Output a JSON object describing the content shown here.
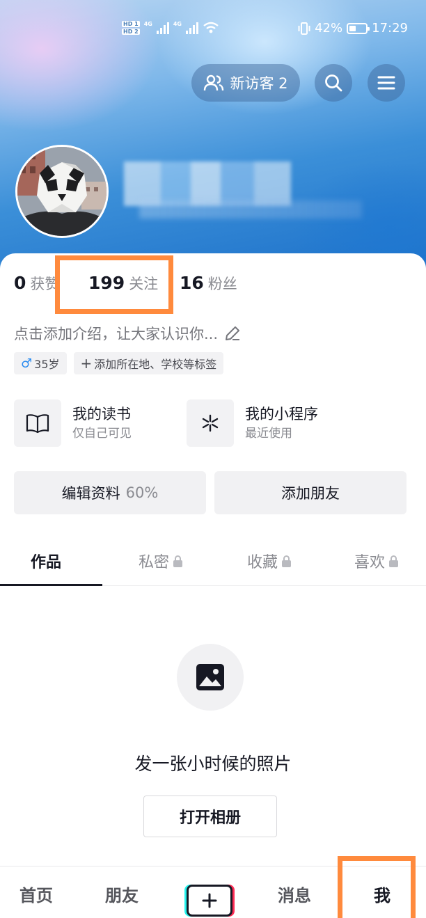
{
  "status_bar": {
    "hd1": "HD 1",
    "hd2": "HD 2",
    "net1": "4G",
    "net2": "4G",
    "battery_text": "42%",
    "battery_level": 0.42,
    "time": "17:29"
  },
  "header": {
    "visitors_label": "新访客 2"
  },
  "stats": {
    "likes_count": "0",
    "likes_label": "获赞",
    "following_count": "199",
    "following_label": "关注",
    "followers_count": "16",
    "followers_label": "粉丝"
  },
  "profile": {
    "bio_placeholder": "点击添加介绍，让大家认识你...",
    "age_tag": "35岁",
    "location_tag": "添加所在地、学校等标签"
  },
  "features": [
    {
      "title": "我的读书",
      "subtitle": "仅自己可见",
      "icon": "book-icon"
    },
    {
      "title": "我的小程序",
      "subtitle": "最近使用",
      "icon": "mini-program-icon"
    }
  ],
  "actions": {
    "edit_profile": "编辑资料",
    "edit_progress": "60%",
    "add_friends": "添加朋友"
  },
  "tabs": [
    {
      "label": "作品",
      "active": true,
      "locked": false
    },
    {
      "label": "私密",
      "active": false,
      "locked": true
    },
    {
      "label": "收藏",
      "active": false,
      "locked": true
    },
    {
      "label": "喜欢",
      "active": false,
      "locked": true
    }
  ],
  "empty_state": {
    "text": "发一张小时候的照片",
    "button": "打开相册"
  },
  "bottom_nav": {
    "home": "首页",
    "friends": "朋友",
    "messages": "消息",
    "me": "我"
  },
  "colors": {
    "highlight": "#ff8a3d",
    "male_blue": "#2b8cf0"
  }
}
